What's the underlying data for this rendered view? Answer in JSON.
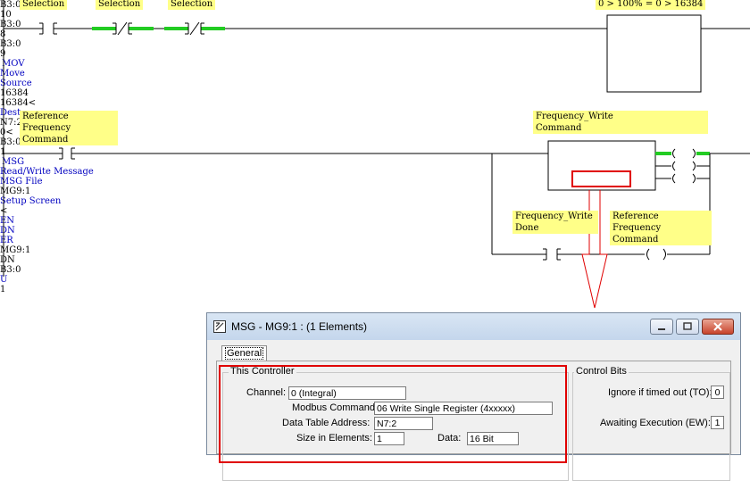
{
  "ladder": {
    "rung1": {
      "labels": [
        "Selection",
        "Selection",
        "Selection"
      ],
      "contacts": [
        {
          "address": "B3:0",
          "bit": "10"
        },
        {
          "address": "B3:0",
          "bit": "8"
        },
        {
          "address": "B3:0",
          "bit": "9"
        }
      ],
      "comment": "0 > 100% = 0 > 16384",
      "mov": {
        "name": "MOV",
        "title": "Move",
        "source_label": "Source",
        "source_value": "16384",
        "source_live": "16384<",
        "dest_label": "Dest",
        "dest_value": "N7:2",
        "dest_live": "0<"
      }
    },
    "rung2": {
      "contact_label_line1": "Reference Frequency",
      "contact_label_line2": "Command",
      "contact_address": "B3:0",
      "contact_bit": "1",
      "msg_label_line1": "Frequency_Write",
      "msg_label_line2": "Command",
      "msg": {
        "name": "MSG",
        "title": "Read/Write Message",
        "file_label": "MSG File",
        "file_value": "MG9:1",
        "setup": "Setup Screen",
        "setup_live": "<",
        "outputs": [
          "EN",
          "DN",
          "ER"
        ]
      },
      "branch_contact_line1": "Frequency_Write",
      "branch_contact_line2": "Done",
      "branch_contact_address": "MG9:1",
      "branch_contact_bit": "DN",
      "unlatch_line1": "Reference Frequency",
      "unlatch_line2": "Command",
      "unlatch_address": "B3:0",
      "unlatch_symbol": "U",
      "unlatch_bit": "1"
    }
  },
  "dialog": {
    "title": "MSG - MG9:1 : (1 Elements)",
    "tab": "General",
    "this_controller": "This Controller",
    "channel_label": "Channel:",
    "channel_value": "0 (Integral)",
    "modbus_label": "Modbus Command:",
    "modbus_value": "06 Write Single Register (4xxxxx)",
    "data_table_label": "Data Table Address:",
    "data_table_value": "N7:2",
    "size_label": "Size in Elements:",
    "size_value": "1",
    "data_label": "Data:",
    "data_value": "16 Bit",
    "control_bits": "Control Bits",
    "ignore_label": "Ignore if timed out (TO):",
    "ignore_value": "0",
    "awaiting_label": "Awaiting Execution (EW):",
    "awaiting_value": "1"
  },
  "colors": {
    "highlight": "#ffff88",
    "energized": "#22cc22",
    "callout": "#e00000",
    "instruction_text": "#0000c0"
  }
}
